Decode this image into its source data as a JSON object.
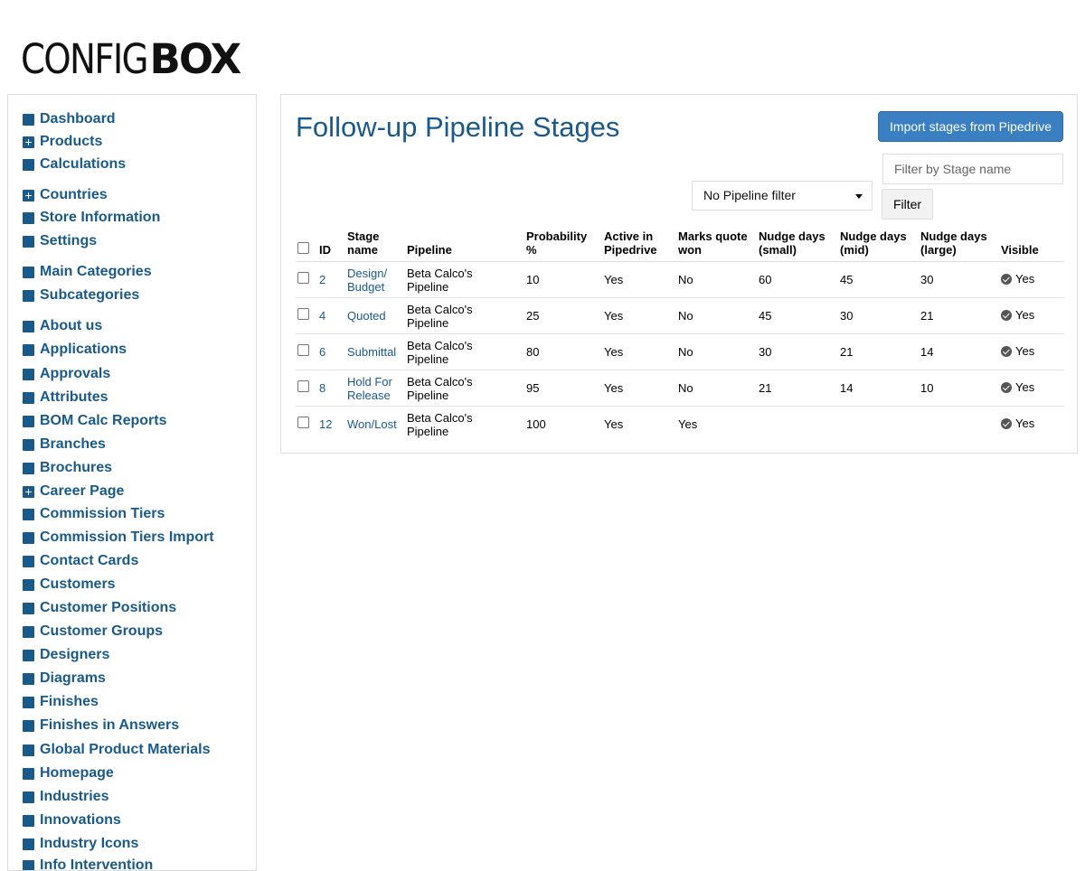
{
  "logo": {
    "light": "CONFIG",
    "bold": "BOX"
  },
  "sidebar": {
    "items": [
      {
        "label": "Dashboard",
        "icon": "square-icon"
      },
      {
        "label": "Products",
        "icon": "plus-box-icon"
      },
      {
        "label": "Calculations",
        "icon": "square-icon"
      },
      {
        "label": "Countries",
        "icon": "plus-box-icon"
      },
      {
        "label": "Store Information",
        "icon": "square-icon"
      },
      {
        "label": "Settings",
        "icon": "square-icon"
      },
      {
        "label": "Main Categories",
        "icon": "square-icon"
      },
      {
        "label": "Subcategories",
        "icon": "square-icon"
      },
      {
        "label": "About us",
        "icon": "square-icon"
      },
      {
        "label": "Applications",
        "icon": "square-icon"
      },
      {
        "label": "Approvals",
        "icon": "square-icon"
      },
      {
        "label": "Attributes",
        "icon": "square-icon"
      },
      {
        "label": "BOM Calc Reports",
        "icon": "square-icon"
      },
      {
        "label": "Branches",
        "icon": "square-icon"
      },
      {
        "label": "Brochures",
        "icon": "square-icon"
      },
      {
        "label": "Career Page",
        "icon": "plus-box-icon"
      },
      {
        "label": "Commission Tiers",
        "icon": "square-icon"
      },
      {
        "label": "Commission Tiers Import",
        "icon": "square-icon"
      },
      {
        "label": "Contact Cards",
        "icon": "square-icon"
      },
      {
        "label": "Customers",
        "icon": "square-icon"
      },
      {
        "label": "Customer Positions",
        "icon": "square-icon"
      },
      {
        "label": "Customer Groups",
        "icon": "square-icon"
      },
      {
        "label": "Designers",
        "icon": "square-icon"
      },
      {
        "label": "Diagrams",
        "icon": "square-icon"
      },
      {
        "label": "Finishes",
        "icon": "square-icon"
      },
      {
        "label": "Finishes in Answers",
        "icon": "square-icon"
      },
      {
        "label": "Global Product Materials",
        "icon": "square-icon"
      },
      {
        "label": "Homepage",
        "icon": "square-icon"
      },
      {
        "label": "Industries",
        "icon": "square-icon"
      },
      {
        "label": "Innovations",
        "icon": "square-icon"
      },
      {
        "label": "Industry Icons",
        "icon": "square-icon"
      },
      {
        "label": "Info Intervention",
        "icon": "square-icon"
      }
    ]
  },
  "main": {
    "title": "Follow-up Pipeline Stages",
    "import_button": "Import stages from Pipedrive",
    "stage_filter_placeholder": "Filter by Stage name",
    "pipeline_filter": "No Pipeline filter",
    "filter_button": "Filter",
    "columns": {
      "id": "ID",
      "stage_name_1": "Stage",
      "stage_name_2": "name",
      "pipeline": "Pipeline",
      "probability_1": "Probability",
      "probability_2": "%",
      "active_1": "Active in",
      "active_2": "Pipedrive",
      "won_1": "Marks quote",
      "won_2": "won",
      "small_1": "Nudge days",
      "small_2": "(small)",
      "mid_1": "Nudge days",
      "mid_2": "(mid)",
      "large_1": "Nudge days",
      "large_2": "(large)",
      "visible": "Visible"
    },
    "rows": [
      {
        "id": "2",
        "name_1": "Design/",
        "name_2": "Budget",
        "pipeline_1": "Beta Calco's",
        "pipeline_2": "Pipeline",
        "probability": "10",
        "active": "Yes",
        "won": "No",
        "small": "60",
        "mid": "45",
        "large": "30",
        "visible": "Yes"
      },
      {
        "id": "4",
        "name_1": "Quoted",
        "name_2": "",
        "pipeline_1": "Beta Calco's",
        "pipeline_2": "Pipeline",
        "probability": "25",
        "active": "Yes",
        "won": "No",
        "small": "45",
        "mid": "30",
        "large": "21",
        "visible": "Yes"
      },
      {
        "id": "6",
        "name_1": "Submittal",
        "name_2": "",
        "pipeline_1": "Beta Calco's",
        "pipeline_2": "Pipeline",
        "probability": "80",
        "active": "Yes",
        "won": "No",
        "small": "30",
        "mid": "21",
        "large": "14",
        "visible": "Yes"
      },
      {
        "id": "8",
        "name_1": "Hold For",
        "name_2": "Release",
        "pipeline_1": "Beta Calco's",
        "pipeline_2": "Pipeline",
        "probability": "95",
        "active": "Yes",
        "won": "No",
        "small": "21",
        "mid": "14",
        "large": "10",
        "visible": "Yes"
      },
      {
        "id": "12",
        "name_1": "Won/Lost",
        "name_2": "",
        "pipeline_1": "Beta Calco's",
        "pipeline_2": "Pipeline",
        "probability": "100",
        "active": "Yes",
        "won": "Yes",
        "small": "",
        "mid": "",
        "large": "",
        "visible": "Yes"
      }
    ]
  },
  "colors": {
    "accent": "#1a5a8a",
    "button": "#3a7fc1"
  }
}
